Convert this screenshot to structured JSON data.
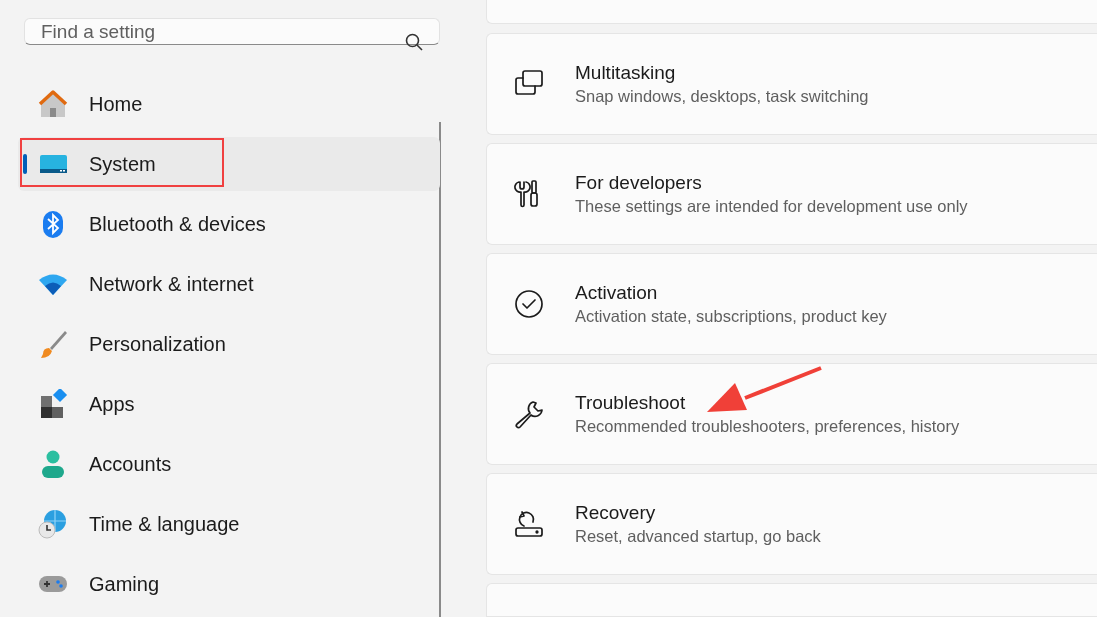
{
  "search": {
    "placeholder": "Find a setting"
  },
  "nav": [
    {
      "label": "Home",
      "selected": false,
      "highlighted": false
    },
    {
      "label": "System",
      "selected": true,
      "highlighted": true
    },
    {
      "label": "Bluetooth & devices",
      "selected": false,
      "highlighted": false
    },
    {
      "label": "Network & internet",
      "selected": false,
      "highlighted": false
    },
    {
      "label": "Personalization",
      "selected": false,
      "highlighted": false
    },
    {
      "label": "Apps",
      "selected": false,
      "highlighted": false
    },
    {
      "label": "Accounts",
      "selected": false,
      "highlighted": false
    },
    {
      "label": "Time & language",
      "selected": false,
      "highlighted": false
    },
    {
      "label": "Gaming",
      "selected": false,
      "highlighted": false
    }
  ],
  "cards": [
    {
      "title": "Multitasking",
      "subtitle": "Snap windows, desktops, task switching",
      "arrow": false
    },
    {
      "title": "For developers",
      "subtitle": "These settings are intended for development use only",
      "arrow": false
    },
    {
      "title": "Activation",
      "subtitle": "Activation state, subscriptions, product key",
      "arrow": false
    },
    {
      "title": "Troubleshoot",
      "subtitle": "Recommended troubleshooters, preferences, history",
      "arrow": true
    },
    {
      "title": "Recovery",
      "subtitle": "Reset, advanced startup, go back",
      "arrow": false
    }
  ]
}
